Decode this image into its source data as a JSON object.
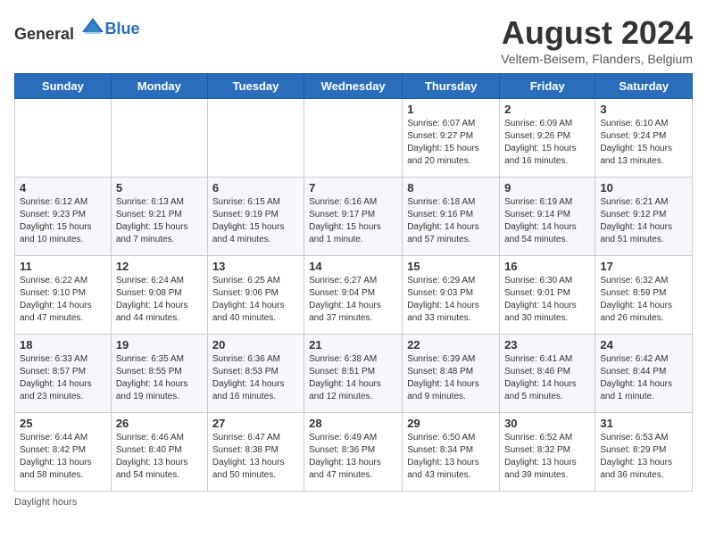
{
  "header": {
    "logo_general": "General",
    "logo_blue": "Blue",
    "month_title": "August 2024",
    "location": "Veltem-Beisem, Flanders, Belgium"
  },
  "days_of_week": [
    "Sunday",
    "Monday",
    "Tuesday",
    "Wednesday",
    "Thursday",
    "Friday",
    "Saturday"
  ],
  "weeks": [
    [
      {
        "day": "",
        "info": ""
      },
      {
        "day": "",
        "info": ""
      },
      {
        "day": "",
        "info": ""
      },
      {
        "day": "",
        "info": ""
      },
      {
        "day": "1",
        "info": "Sunrise: 6:07 AM\nSunset: 9:27 PM\nDaylight: 15 hours\nand 20 minutes."
      },
      {
        "day": "2",
        "info": "Sunrise: 6:09 AM\nSunset: 9:26 PM\nDaylight: 15 hours\nand 16 minutes."
      },
      {
        "day": "3",
        "info": "Sunrise: 6:10 AM\nSunset: 9:24 PM\nDaylight: 15 hours\nand 13 minutes."
      }
    ],
    [
      {
        "day": "4",
        "info": "Sunrise: 6:12 AM\nSunset: 9:23 PM\nDaylight: 15 hours\nand 10 minutes."
      },
      {
        "day": "5",
        "info": "Sunrise: 6:13 AM\nSunset: 9:21 PM\nDaylight: 15 hours\nand 7 minutes."
      },
      {
        "day": "6",
        "info": "Sunrise: 6:15 AM\nSunset: 9:19 PM\nDaylight: 15 hours\nand 4 minutes."
      },
      {
        "day": "7",
        "info": "Sunrise: 6:16 AM\nSunset: 9:17 PM\nDaylight: 15 hours\nand 1 minute."
      },
      {
        "day": "8",
        "info": "Sunrise: 6:18 AM\nSunset: 9:16 PM\nDaylight: 14 hours\nand 57 minutes."
      },
      {
        "day": "9",
        "info": "Sunrise: 6:19 AM\nSunset: 9:14 PM\nDaylight: 14 hours\nand 54 minutes."
      },
      {
        "day": "10",
        "info": "Sunrise: 6:21 AM\nSunset: 9:12 PM\nDaylight: 14 hours\nand 51 minutes."
      }
    ],
    [
      {
        "day": "11",
        "info": "Sunrise: 6:22 AM\nSunset: 9:10 PM\nDaylight: 14 hours\nand 47 minutes."
      },
      {
        "day": "12",
        "info": "Sunrise: 6:24 AM\nSunset: 9:08 PM\nDaylight: 14 hours\nand 44 minutes."
      },
      {
        "day": "13",
        "info": "Sunrise: 6:25 AM\nSunset: 9:06 PM\nDaylight: 14 hours\nand 40 minutes."
      },
      {
        "day": "14",
        "info": "Sunrise: 6:27 AM\nSunset: 9:04 PM\nDaylight: 14 hours\nand 37 minutes."
      },
      {
        "day": "15",
        "info": "Sunrise: 6:29 AM\nSunset: 9:03 PM\nDaylight: 14 hours\nand 33 minutes."
      },
      {
        "day": "16",
        "info": "Sunrise: 6:30 AM\nSunset: 9:01 PM\nDaylight: 14 hours\nand 30 minutes."
      },
      {
        "day": "17",
        "info": "Sunrise: 6:32 AM\nSunset: 8:59 PM\nDaylight: 14 hours\nand 26 minutes."
      }
    ],
    [
      {
        "day": "18",
        "info": "Sunrise: 6:33 AM\nSunset: 8:57 PM\nDaylight: 14 hours\nand 23 minutes."
      },
      {
        "day": "19",
        "info": "Sunrise: 6:35 AM\nSunset: 8:55 PM\nDaylight: 14 hours\nand 19 minutes."
      },
      {
        "day": "20",
        "info": "Sunrise: 6:36 AM\nSunset: 8:53 PM\nDaylight: 14 hours\nand 16 minutes."
      },
      {
        "day": "21",
        "info": "Sunrise: 6:38 AM\nSunset: 8:51 PM\nDaylight: 14 hours\nand 12 minutes."
      },
      {
        "day": "22",
        "info": "Sunrise: 6:39 AM\nSunset: 8:48 PM\nDaylight: 14 hours\nand 9 minutes."
      },
      {
        "day": "23",
        "info": "Sunrise: 6:41 AM\nSunset: 8:46 PM\nDaylight: 14 hours\nand 5 minutes."
      },
      {
        "day": "24",
        "info": "Sunrise: 6:42 AM\nSunset: 8:44 PM\nDaylight: 14 hours\nand 1 minute."
      }
    ],
    [
      {
        "day": "25",
        "info": "Sunrise: 6:44 AM\nSunset: 8:42 PM\nDaylight: 13 hours\nand 58 minutes."
      },
      {
        "day": "26",
        "info": "Sunrise: 6:46 AM\nSunset: 8:40 PM\nDaylight: 13 hours\nand 54 minutes."
      },
      {
        "day": "27",
        "info": "Sunrise: 6:47 AM\nSunset: 8:38 PM\nDaylight: 13 hours\nand 50 minutes."
      },
      {
        "day": "28",
        "info": "Sunrise: 6:49 AM\nSunset: 8:36 PM\nDaylight: 13 hours\nand 47 minutes."
      },
      {
        "day": "29",
        "info": "Sunrise: 6:50 AM\nSunset: 8:34 PM\nDaylight: 13 hours\nand 43 minutes."
      },
      {
        "day": "30",
        "info": "Sunrise: 6:52 AM\nSunset: 8:32 PM\nDaylight: 13 hours\nand 39 minutes."
      },
      {
        "day": "31",
        "info": "Sunrise: 6:53 AM\nSunset: 8:29 PM\nDaylight: 13 hours\nand 36 minutes."
      }
    ]
  ],
  "footer": {
    "daylight_label": "Daylight hours"
  }
}
